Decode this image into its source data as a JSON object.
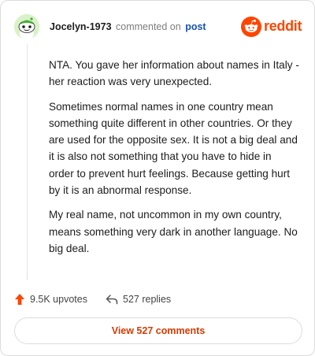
{
  "header": {
    "username": "Jocelyn-1973",
    "commented_text": "commented on",
    "post_link": "post",
    "brand": "reddit"
  },
  "comment": {
    "paragraphs": [
      "NTA. You gave her information about names in Italy - her reaction was very unexpected.",
      "Sometimes normal names in one country mean something quite different in other countries. Or they are used for the opposite sex. It is not a big deal and it is also not something that you have to hide in order to prevent hurt feelings. Because getting hurt by it is an abnormal response.",
      "My real name, not uncommon in my own country, means something very dark in another language. No big deal."
    ]
  },
  "actions": {
    "upvotes": "9.5K upvotes",
    "replies": "527 replies"
  },
  "footer": {
    "view_comments": "View 527 comments"
  },
  "icons": {
    "avatar": "snoo-avatar-icon",
    "logo": "reddit-logo-icon",
    "upvote": "upvote-arrow-icon",
    "reply": "reply-arrow-icon"
  },
  "colors": {
    "brand": "#ff4500",
    "upvote": "#ff4500",
    "link": "#1a53a8",
    "view_button_text": "#d93a00"
  }
}
